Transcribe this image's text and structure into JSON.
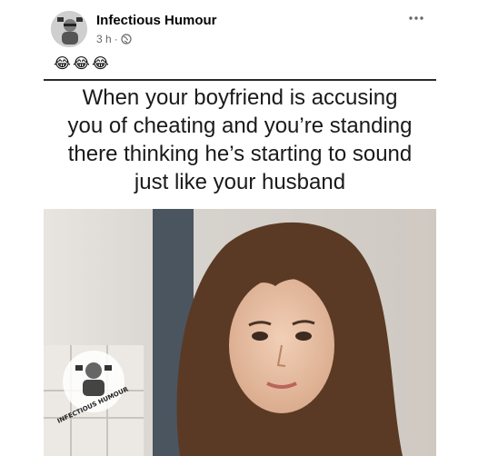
{
  "post": {
    "author": "Infectious Humour",
    "time": "3 h",
    "separator": "·",
    "privacy_icon": "globe-icon",
    "more_icon": "more-options-icon",
    "reaction_text": [
      "😂",
      "😂",
      "😂"
    ]
  },
  "meme": {
    "caption_lines": [
      "When your boyfriend is accusing",
      "you of cheating and you’re standing",
      "there thinking he’s starting to sound",
      "just like your husband"
    ],
    "watermark_text": "INFECTIOUS HUMOUR"
  },
  "colors": {
    "name": "#050505",
    "meta": "#65676b",
    "hair": "#5a3a24",
    "skin": "#e8c2a6"
  }
}
